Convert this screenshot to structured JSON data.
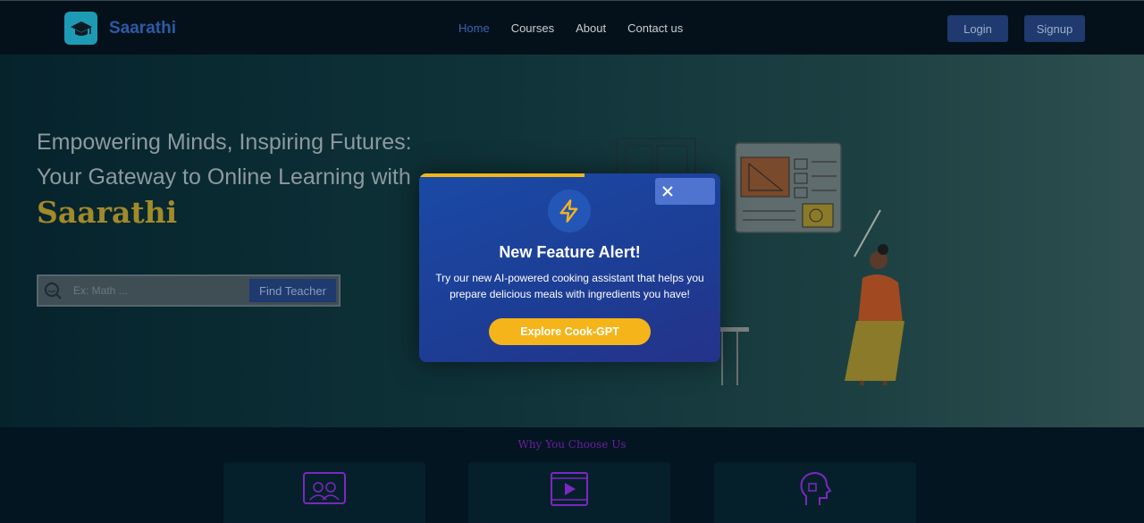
{
  "nav": {
    "brand": "Saarathi",
    "links": [
      "Home",
      "Courses",
      "About",
      "Contact us"
    ],
    "login": "Login",
    "signup": "Signup"
  },
  "hero": {
    "line1": "Empowering Minds, Inspiring Futures:",
    "line2": "Your Gateway to Online Learning with",
    "brand": "Saarathi",
    "search_placeholder": "Ex: Math ...",
    "find_button": "Find Teacher"
  },
  "modal": {
    "title": "New Feature Alert!",
    "body": "Try our new AI-powered cooking assistant that helps you prepare delicious meals with ingredients you have!",
    "cta": "Explore Cook-GPT",
    "progress": 0.55
  },
  "section": {
    "title": "Why You Choose Us"
  },
  "colors": {
    "accent": "#f5b51a",
    "modal_bg": "#1d3d94",
    "nav_button": "#1e3a6e"
  }
}
